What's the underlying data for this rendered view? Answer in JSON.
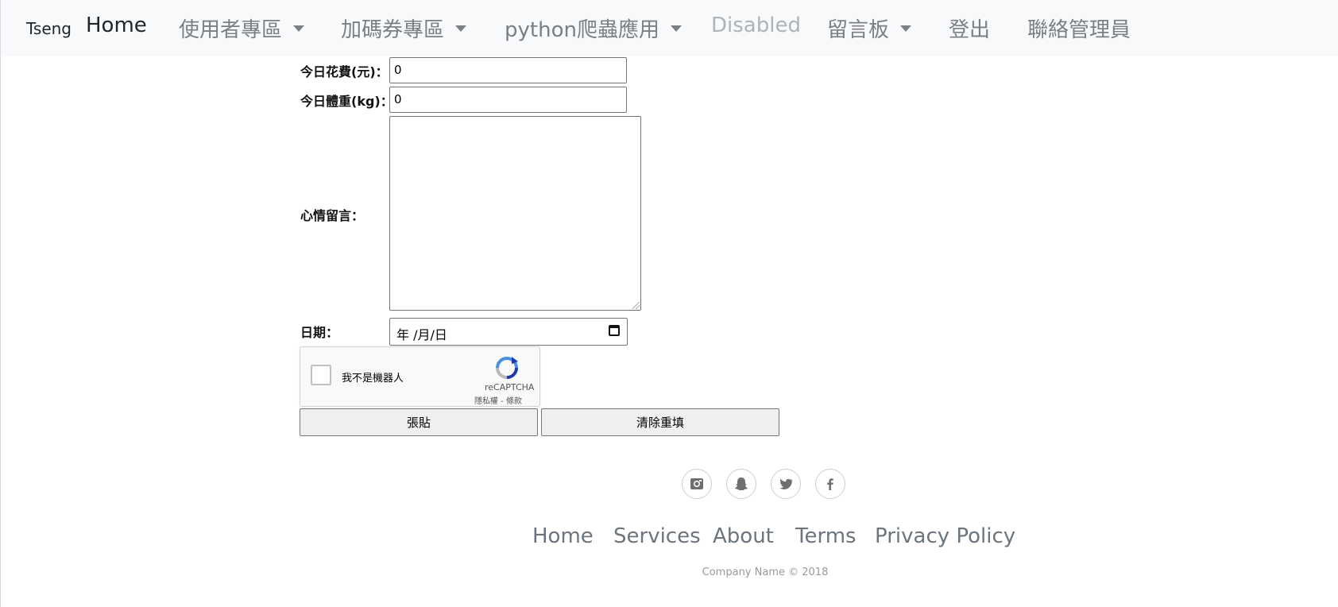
{
  "navbar": {
    "brand": "Tseng",
    "items": [
      {
        "label": "Home",
        "dropdown": false,
        "state": "active"
      },
      {
        "label": "使用者專區",
        "dropdown": true,
        "state": "normal"
      },
      {
        "label": "加碼券專區",
        "dropdown": true,
        "state": "normal"
      },
      {
        "label": "python爬蟲應用",
        "dropdown": true,
        "state": "normal"
      },
      {
        "label": "Disabled",
        "dropdown": false,
        "state": "disabled"
      },
      {
        "label": "留言板",
        "dropdown": true,
        "state": "normal"
      },
      {
        "label": "登出",
        "dropdown": false,
        "state": "normal"
      },
      {
        "label": "聯絡管理員",
        "dropdown": false,
        "state": "normal"
      }
    ]
  },
  "form": {
    "spend_label": "今日花費(元)：",
    "spend_value": "0",
    "weight_label": "今日體重(kg)：",
    "weight_value": "0",
    "mood_label": "心情留言：",
    "mood_value": "",
    "date_label": "日期：",
    "date_placeholder": "年 /月/日",
    "captcha": {
      "checkbox_label": "我不是機器人",
      "brand": "reCAPTCHA",
      "links": "隱私權 - 條款"
    },
    "submit_label": "張貼",
    "reset_label": "清除重填"
  },
  "footer": {
    "social_icons": [
      "instagram-icon",
      "snapchat-icon",
      "twitter-icon",
      "facebook-icon"
    ],
    "links": [
      "Home",
      "Services",
      "About",
      "Terms",
      "Privacy Policy"
    ],
    "copyright": "Company Name © 2018"
  }
}
